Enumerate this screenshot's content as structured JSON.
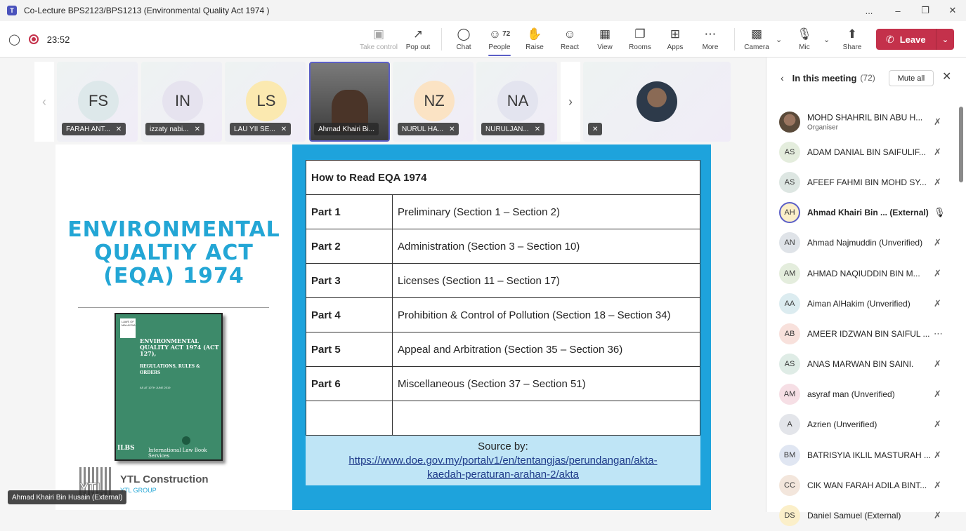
{
  "window": {
    "title": "Co-Lecture BPS2123/BPS1213 (Environmental Quality Act 1974 )",
    "controls": [
      "...",
      "–",
      "❐",
      "✕"
    ]
  },
  "toolbar": {
    "timer": "23:52",
    "buttons": [
      {
        "label": "Take control",
        "icon": "take-control-icon"
      },
      {
        "label": "Pop out",
        "icon": "pop-out-icon"
      },
      {
        "label": "Chat",
        "icon": "chat-icon"
      },
      {
        "label": "People",
        "icon": "people-icon",
        "badge": "72"
      },
      {
        "label": "Raise",
        "icon": "hand-icon"
      },
      {
        "label": "React",
        "icon": "smiley-icon"
      },
      {
        "label": "View",
        "icon": "grid-icon"
      },
      {
        "label": "Rooms",
        "icon": "rooms-icon"
      },
      {
        "label": "Apps",
        "icon": "plus-icon"
      },
      {
        "label": "More",
        "icon": "more-icon"
      },
      {
        "label": "Camera",
        "icon": "camera-off-icon"
      },
      {
        "label": "Mic",
        "icon": "mic-off-icon"
      },
      {
        "label": "Share",
        "icon": "share-icon"
      }
    ],
    "leave_label": "Leave"
  },
  "tiles": [
    {
      "initials": "FS",
      "name": "FARAH ANT...",
      "color": "#dde8ea"
    },
    {
      "initials": "IN",
      "name": "izzaty nabi...",
      "color": "#e6e3ef"
    },
    {
      "initials": "LS",
      "name": "LAU YII SE...",
      "color": "#fbe9b0"
    },
    {
      "initials": "",
      "name": "Ahmad Khairi Bi...",
      "color": "#555"
    },
    {
      "initials": "NZ",
      "name": "NURUL HA...",
      "color": "#fbe3c4"
    },
    {
      "initials": "NA",
      "name": "NURULJAN...",
      "color": "#e3e4ef"
    }
  ],
  "slide": {
    "title_lines": [
      "ENVIRONMENTAL",
      "QUALTIY ACT",
      "(EQA) 1974"
    ],
    "book": {
      "label": "LAWS OF MALAYSIA",
      "title": "ENVIRONMENTAL QUALITY ACT 1974 (ACT 127),",
      "subtitle": "REGULATIONS, RULES & ORDERS",
      "asat": "AS AT 10TH JUNE 2019",
      "publisher": "International Law Book Services",
      "ilbs": "ILBS"
    },
    "logo": {
      "name": "YTL Construction",
      "sub": "YTL GROUP",
      "mark": "YTL"
    },
    "table_header": "How to Read EQA 1974",
    "rows": [
      {
        "part": "Part 1",
        "desc": "Preliminary (Section 1 – Section 2)"
      },
      {
        "part": "Part 2",
        "desc": "Administration (Section 3 – Section 10)"
      },
      {
        "part": "Part 3",
        "desc": "Licenses (Section 11 – Section 17)"
      },
      {
        "part": "Part 4",
        "desc": "Prohibition & Control of Pollution (Section 18 – Section 34)"
      },
      {
        "part": "Part 5",
        "desc": "Appeal and Arbitration (Section 35 – Section 36)"
      },
      {
        "part": "Part 6",
        "desc": "Miscellaneous (Section 37 – Section 51)"
      },
      {
        "part": "",
        "desc": ""
      }
    ],
    "source_label": "Source by:",
    "source_link_1": "https://www.doe.gov.my/portalv1/en/tentangjas/perundangan/akta-",
    "source_link_2": "kaedah-peraturan-arahan-2/akta"
  },
  "presenter_tag": "Ahmad Khairi Bin Husain (External)",
  "panel": {
    "title": "In this meeting",
    "count": "(72)",
    "mute_all": "Mute all",
    "participants": [
      {
        "initials": "",
        "name": "MOHD SHAHRIL BIN ABU H...",
        "role": "Organiser",
        "color": "#6b5b4a",
        "mic": "mic-off"
      },
      {
        "initials": "AS",
        "name": "ADAM DANIAL BIN SAIFULIF...",
        "color": "#e4eddd",
        "mic": "mic-off"
      },
      {
        "initials": "AS",
        "name": "AFEEF FAHMI BIN MOHD SY...",
        "color": "#dde6e2",
        "mic": "mic-off"
      },
      {
        "initials": "AH",
        "name": "Ahmad Khairi Bin ... (External)",
        "color": "#fbefc9",
        "mic": "mic-on",
        "bold": true
      },
      {
        "initials": "AN",
        "name": "Ahmad Najmuddin (Unverified)",
        "color": "#dfe3e8",
        "mic": "mic-off"
      },
      {
        "initials": "AM",
        "name": "AHMAD NAQIUDDIN BIN M...",
        "color": "#e4eddd",
        "mic": "mic-off"
      },
      {
        "initials": "AA",
        "name": "Aiman AlHakim (Unverified)",
        "color": "#dcecf0",
        "mic": "mic-off"
      },
      {
        "initials": "AB",
        "name": "AMEER IDZWAN BIN SAIFUL ...",
        "color": "#f8e1dc",
        "mic": "more"
      },
      {
        "initials": "AS",
        "name": "ANAS MARWAN BIN SAINI.",
        "color": "#dfece6",
        "mic": "mic-off"
      },
      {
        "initials": "AM",
        "name": "asyraf man (Unverified)",
        "color": "#f6dfe5",
        "mic": "mic-off"
      },
      {
        "initials": "A",
        "name": "Azrien (Unverified)",
        "color": "#e3e5ea",
        "mic": "mic-off"
      },
      {
        "initials": "BM",
        "name": "BATRISYIA IKLIL MASTURAH ...",
        "color": "#e0e6f2",
        "mic": "mic-off"
      },
      {
        "initials": "CC",
        "name": "CIK WAN FARAH ADILA BINT...",
        "color": "#f3e6dc",
        "mic": "mic-off"
      },
      {
        "initials": "DS",
        "name": "Daniel Samuel (External)",
        "color": "#fbefc9",
        "mic": "mic-off"
      }
    ]
  }
}
